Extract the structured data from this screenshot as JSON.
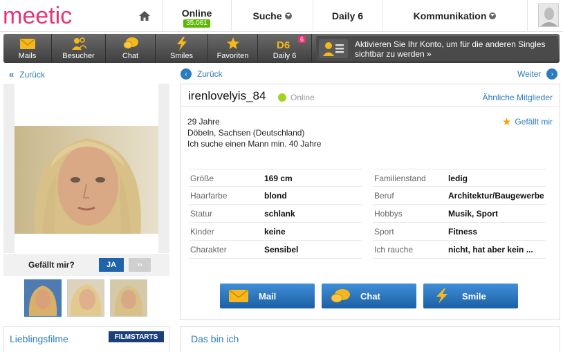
{
  "brand": {
    "logo_text": "meetic",
    "colors": {
      "accent": "#2b7bbd",
      "brand_pink": "#e5357a",
      "online_green": "#5cb900"
    }
  },
  "nav": {
    "home_icon": "home-icon",
    "online_label": "Online",
    "online_count": "35.061",
    "suche_label": "Suche",
    "daily_label": "Daily 6",
    "kommunikation_label": "Kommunikation"
  },
  "toolbar": {
    "mails": "Mails",
    "besucher": "Besucher",
    "chat": "Chat",
    "smiles": "Smiles",
    "favoriten": "Favoriten",
    "daily6": "Daily 6",
    "daily6_icon_text": "D6",
    "daily6_badge": "6",
    "promo_text": "Aktivieren Sie Ihr Konto, um für die anderen Singles sichtbar zu werden »"
  },
  "navigation": {
    "back_left": "Zurück",
    "back_right": "Zurück",
    "weiter": "Weiter"
  },
  "left": {
    "like_question": "Gefällt mir?",
    "ja": "JA",
    "skip": "››"
  },
  "profile": {
    "username": "irenlovelyis_84",
    "status": "Online",
    "similar_members": "Ähnliche Mitglieder",
    "age": "29 Jahre",
    "location": "Döbeln, Sachsen (Deutschland)",
    "seeking": "Ich suche einen Mann min. 40 Jahre",
    "like_me": "Gefällt mir",
    "attributes_left": [
      {
        "key": "Größe",
        "value": "169 cm"
      },
      {
        "key": "Haarfarbe",
        "value": "blond"
      },
      {
        "key": "Statur",
        "value": "schlank"
      },
      {
        "key": "Kinder",
        "value": "keine"
      },
      {
        "key": "Charakter",
        "value": "Sensibel"
      }
    ],
    "attributes_right": [
      {
        "key": "Familienstand",
        "value": "ledig"
      },
      {
        "key": "Beruf",
        "value": "Architektur/Baugewerbe"
      },
      {
        "key": "Hobbys",
        "value": "Musik, Sport"
      },
      {
        "key": "Sport",
        "value": "Fitness"
      },
      {
        "key": "Ich rauche",
        "value": "nicht, hat aber kein ..."
      }
    ],
    "actions": {
      "mail": "Mail",
      "chat": "Chat",
      "smile": "Smile"
    }
  },
  "bottom": {
    "favorite_movies": "Lieblingsfilme",
    "filmstarts": "FILMSTARTS",
    "about_me": "Das bin ich"
  }
}
